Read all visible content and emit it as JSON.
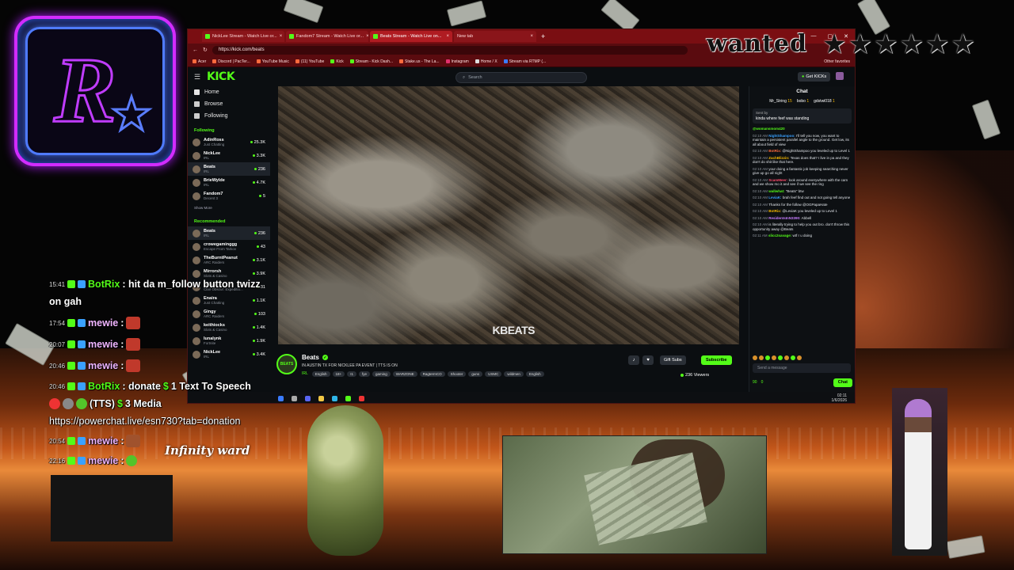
{
  "browser": {
    "tabs": [
      {
        "label": "NickLee Stream - Watch Live or...",
        "active": false
      },
      {
        "label": "Fandom7 Stream - Watch Live or...",
        "active": false
      },
      {
        "label": "Beats Stream - Watch Live on...",
        "active": true
      },
      {
        "label": "New tab",
        "active": false
      }
    ],
    "url": "https://kick.com/beats",
    "bookmarks": [
      "Acer",
      "Discord | PacTer...",
      "YouTube Music",
      "(11) YouTube",
      "Kick",
      "Stream - Kick Dash...",
      "Stake.us - The La...",
      "Instagram",
      "Home / X",
      "Stream via RTMP (..."
    ],
    "other_favorites": "Other favorites"
  },
  "kick": {
    "logo": "KICK",
    "search_placeholder": "Search",
    "get_kicks": "Get KICKs",
    "nav": {
      "home": "Home",
      "browse": "Browse",
      "following": "Following"
    },
    "following_header": "Following",
    "following": [
      {
        "name": "AdinRoss",
        "sub": "Just Chatting",
        "count": "25.3K"
      },
      {
        "name": "NickLee",
        "sub": "IRL",
        "count": "3.3K"
      },
      {
        "name": "Beats",
        "sub": "IRL",
        "count": "236"
      },
      {
        "name": "BrieWylde",
        "sub": "IRL",
        "count": "4.7K"
      },
      {
        "name": "Fandom7",
        "sub": "Decent 3",
        "count": "5"
      }
    ],
    "show_more": "Show More",
    "recommended_header": "Recommended",
    "recommended": [
      {
        "name": "Beats",
        "sub": "IRL",
        "count": "236"
      },
      {
        "name": "crowegaminggg",
        "sub": "Escape From Tarkov",
        "count": "43"
      },
      {
        "name": "TheBurntPeanut",
        "sub": "ARC Raiders",
        "count": "3.1K"
      },
      {
        "name": "Mirrorsh",
        "sub": "Slots & Casino",
        "count": "3.9K"
      },
      {
        "name": "Mivea",
        "sub": "Clair Obscur: Expeditio...",
        "count": "31"
      },
      {
        "name": "Enaira",
        "sub": "Just Chatting",
        "count": "1.1K"
      },
      {
        "name": "Gingy",
        "sub": "ARC Raiders",
        "count": "103"
      },
      {
        "name": "keithiocks",
        "sub": "Slots & Casino",
        "count": "1.4K"
      },
      {
        "name": "lunalynk",
        "sub": "Fortnite",
        "count": "1.9K"
      },
      {
        "name": "NickLee",
        "sub": "IRL",
        "count": "3.4K"
      }
    ],
    "video_watermark": "KBEATS",
    "channel": {
      "avatar_text": "BEATS",
      "name": "Beats",
      "title": "IN AUSTIN TX FOR NICKLEE PA EVENT | TTS IS ON",
      "category": "IRL",
      "tags": [
        "English",
        "18+",
        "I1",
        "fye",
        "gaming",
        "WARZONE",
        "RagtermCO",
        "Shooter",
        "guns",
        "USMC",
        "wildmen",
        "English"
      ],
      "gift_subs": "Gift Subs",
      "subscribe": "Subscribe",
      "viewers": "236 Viewers"
    },
    "chat": {
      "header": "Chat",
      "gifters": [
        {
          "name": "Mr_String",
          "count": "15"
        },
        {
          "name": "bobo",
          "count": "1"
        },
        {
          "name": "gdstwi018",
          "count": "1"
        }
      ],
      "pinned_by": "Sent by",
      "pinned_text": "kinda where feef was standing",
      "messages": [
        {
          "time": "",
          "user": "@womansmom420",
          "text": ""
        },
        {
          "time": "02:10 AM",
          "user": "NightShampoo:",
          "text": "I'll tell you now, you want to maintain a persistent parallel angle to the ground. Get low, its all about field of view"
        },
        {
          "time": "02:10 AM",
          "user": "BotRix:",
          "text": "@NightShampoo you leveled up to Level 1"
        },
        {
          "time": "02:10 AM",
          "user": "ZachBlizzin:",
          "text": "Texas does that? I live in pa and they don't do shit like that here."
        },
        {
          "time": "02:10 AM",
          "user": "",
          "text": "your doing a fantastic job keeping searching never give up go all night"
        },
        {
          "time": "02:10 AM",
          "user": "ScamMeer:",
          "text": "look around everywhere with the cam and we show mo it and see if we see the ring"
        },
        {
          "time": "02:10 AM",
          "user": "wallwhat:",
          "text": "\"Beats\" btw"
        },
        {
          "time": "02:10 AM",
          "user": "LeviaK:",
          "text": "brah feef find out and not going tell anyone"
        },
        {
          "time": "02:10 AM",
          "user": "",
          "text": "Thanks for the follow @OGPapaHate"
        },
        {
          "time": "02:10 AM",
          "user": "BotRix:",
          "text": "@LeviaK you leveled up to Level 1"
        },
        {
          "time": "02:10 AM",
          "user": "ResidentsInN3390:",
          "text": "Abbell"
        },
        {
          "time": "02:10 AM",
          "user": "",
          "text": "is literally trying to help you out bro. don't throw this opportunity away @Beats"
        },
        {
          "time": "02:11 AM",
          "user": "slicc2savage:",
          "text": "wtf r u doing"
        }
      ],
      "input_placeholder": "Send a message",
      "kicks": "90",
      "points": "0",
      "chat_button": "Chat"
    },
    "clock": {
      "time": "02:11",
      "date": "1/6/2026"
    }
  },
  "overlay": {
    "wanted": "wanted",
    "rows": [
      {
        "time": "15:41",
        "user": "BotRix",
        "text": ": hit da m_follow button twizz"
      },
      {
        "time": "",
        "user": "",
        "text": "on gah"
      },
      {
        "time": "17:54",
        "user": "mewie",
        "text": ":"
      },
      {
        "time": "20:07",
        "user": "mewie",
        "text": ":"
      },
      {
        "time": "20:46",
        "user": "mewie",
        "text": ":"
      },
      {
        "time": "20:46",
        "user": "BotRix",
        "text": ": donate"
      },
      {
        "time": "",
        "user": "",
        "text": "(TTS)"
      },
      {
        "time": "",
        "user": "",
        "text": "https://powerchat.live/esn730?tab=donation"
      },
      {
        "time": "20:54",
        "user": "mewie",
        "text": ":"
      },
      {
        "time": "22:16",
        "user": "mewie",
        "text": ":"
      }
    ],
    "donate_tail": "1 Text To Speech",
    "media_label": "3 Media",
    "infinity_ward": "Infinity ward",
    "colors": {
      "accent": "#53fc18",
      "tab_red": "#7a0e12",
      "neon_pink": "#d22cff",
      "neon_blue": "#4f7bff"
    }
  }
}
